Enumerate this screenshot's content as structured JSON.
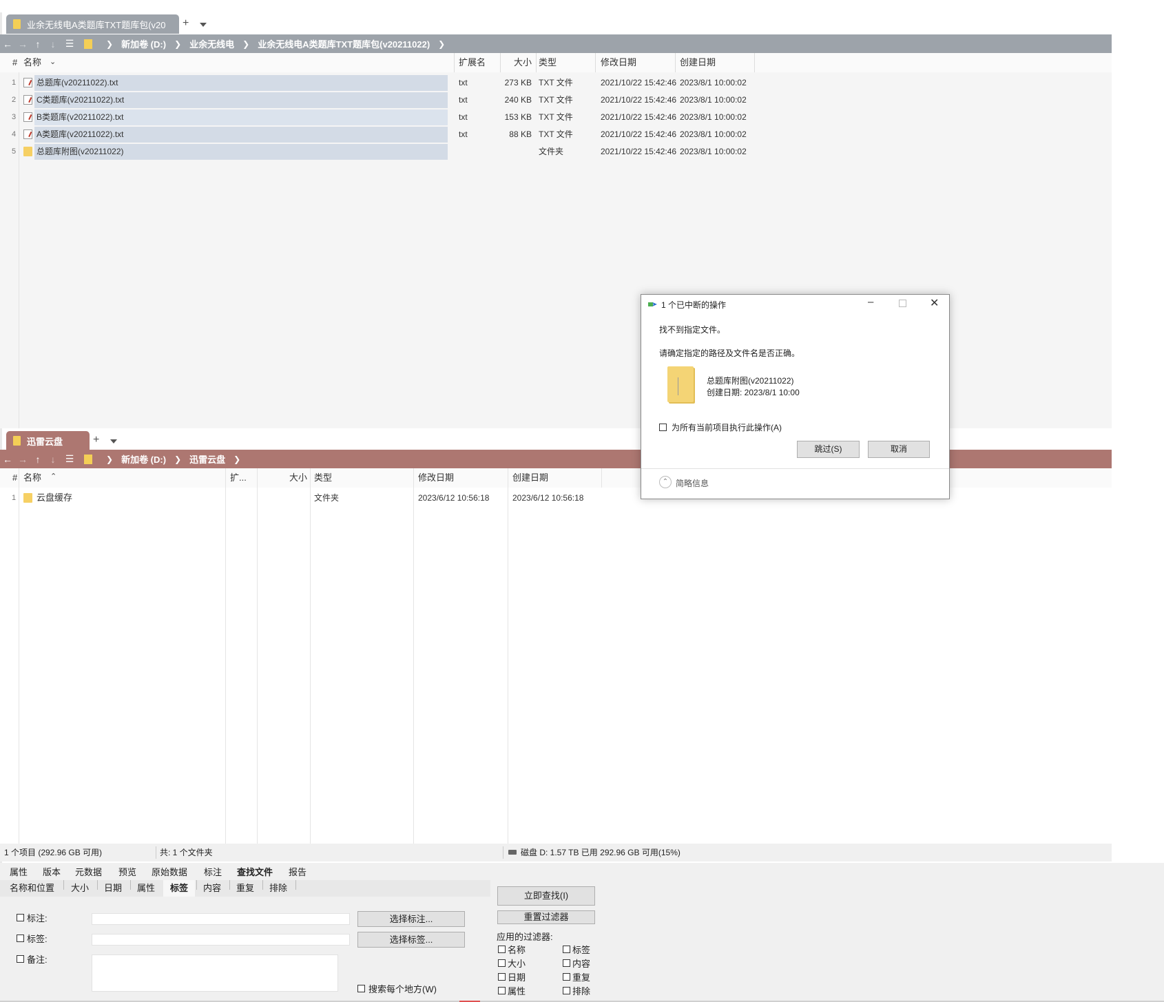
{
  "colors": {
    "top_pane_accent": "#9da3aa",
    "bottom_pane_accent": "#ad7771",
    "selection": "#d3dbe6",
    "folder": "#f4cf56"
  },
  "top_pane": {
    "tab_title": "业余无线电A类题库TXT题库包(v20",
    "breadcrumb": [
      "新加卷 (D:)",
      "业余无线电",
      "业余无线电A类题库TXT题库包(v20211022)"
    ],
    "columns": [
      "#",
      "名称",
      "扩展名",
      "大小",
      "类型",
      "修改日期",
      "创建日期"
    ],
    "rows": [
      {
        "num": "1",
        "name": "总题库(v20211022).txt",
        "ext": "txt",
        "size": "273 KB",
        "type": "TXT 文件",
        "modified": "2021/10/22 15:42:46",
        "created": "2023/8/1 10:00:02",
        "icon": "txt"
      },
      {
        "num": "2",
        "name": "C类题库(v20211022).txt",
        "ext": "txt",
        "size": "240 KB",
        "type": "TXT 文件",
        "modified": "2021/10/22 15:42:46",
        "created": "2023/8/1 10:00:02",
        "icon": "txt"
      },
      {
        "num": "3",
        "name": "B类题库(v20211022).txt",
        "ext": "txt",
        "size": "153 KB",
        "type": "TXT 文件",
        "modified": "2021/10/22 15:42:46",
        "created": "2023/8/1 10:00:02",
        "icon": "txt"
      },
      {
        "num": "4",
        "name": "A类题库(v20211022).txt",
        "ext": "txt",
        "size": "88 KB",
        "type": "TXT 文件",
        "modified": "2021/10/22 15:42:46",
        "created": "2023/8/1 10:00:02",
        "icon": "txt"
      },
      {
        "num": "5",
        "name": "总题库附图(v20211022)",
        "ext": "",
        "size": "",
        "type": "文件夹",
        "modified": "2021/10/22 15:42:46",
        "created": "2023/8/1 10:00:02",
        "icon": "folder"
      }
    ]
  },
  "bottom_pane": {
    "tab_title": "迅雷云盘",
    "breadcrumb": [
      "新加卷 (D:)",
      "迅雷云盘"
    ],
    "columns": [
      "#",
      "名称",
      "扩...",
      "大小",
      "类型",
      "修改日期",
      "创建日期"
    ],
    "rows": [
      {
        "num": "1",
        "name": "云盘缓存",
        "type": "文件夹",
        "modified": "2023/6/12 10:56:18",
        "created": "2023/6/12 10:56:18"
      }
    ]
  },
  "status": {
    "items": "1 个项目 (292.96 GB 可用)",
    "total": "共: 1 个文件夹",
    "disk": "磁盘 D:  1.57 TB 已用   292.96 GB 可用(15%)"
  },
  "info_panel": {
    "tabs": [
      "属性",
      "版本",
      "元数据",
      "预览",
      "原始数据",
      "标注",
      "查找文件",
      "报告"
    ],
    "active_tab": "查找文件",
    "subtabs": [
      "名称和位置",
      "大小",
      "日期",
      "属性",
      "标签",
      "内容",
      "重复",
      "排除"
    ],
    "active_subtab": "标签",
    "label_mark": "标注:",
    "label_tag": "标签:",
    "label_note": "备注:",
    "btn_select_mark": "选择标注...",
    "btn_select_tag": "选择标签...",
    "search_everywhere": "搜索每个地方(W)",
    "btn_find_now": "立即查找(I)",
    "btn_reset_filters": "重置过滤器",
    "applied_filters_label": "应用的过滤器:",
    "filters": [
      "名称",
      "标签",
      "大小",
      "内容",
      "日期",
      "重复",
      "属性",
      "排除"
    ]
  },
  "dialog": {
    "title": "1 个已中断的操作",
    "message": "找不到指定文件。",
    "hint": "请确定指定的路径及文件名是否正确。",
    "file_name": "总题库附图(v20211022)",
    "file_created": "创建日期: 2023/8/1 10:00",
    "apply_all": "为所有当前项目执行此操作(A)",
    "skip_button": "跳过(S)",
    "cancel_button": "取消",
    "details": "简略信息"
  }
}
